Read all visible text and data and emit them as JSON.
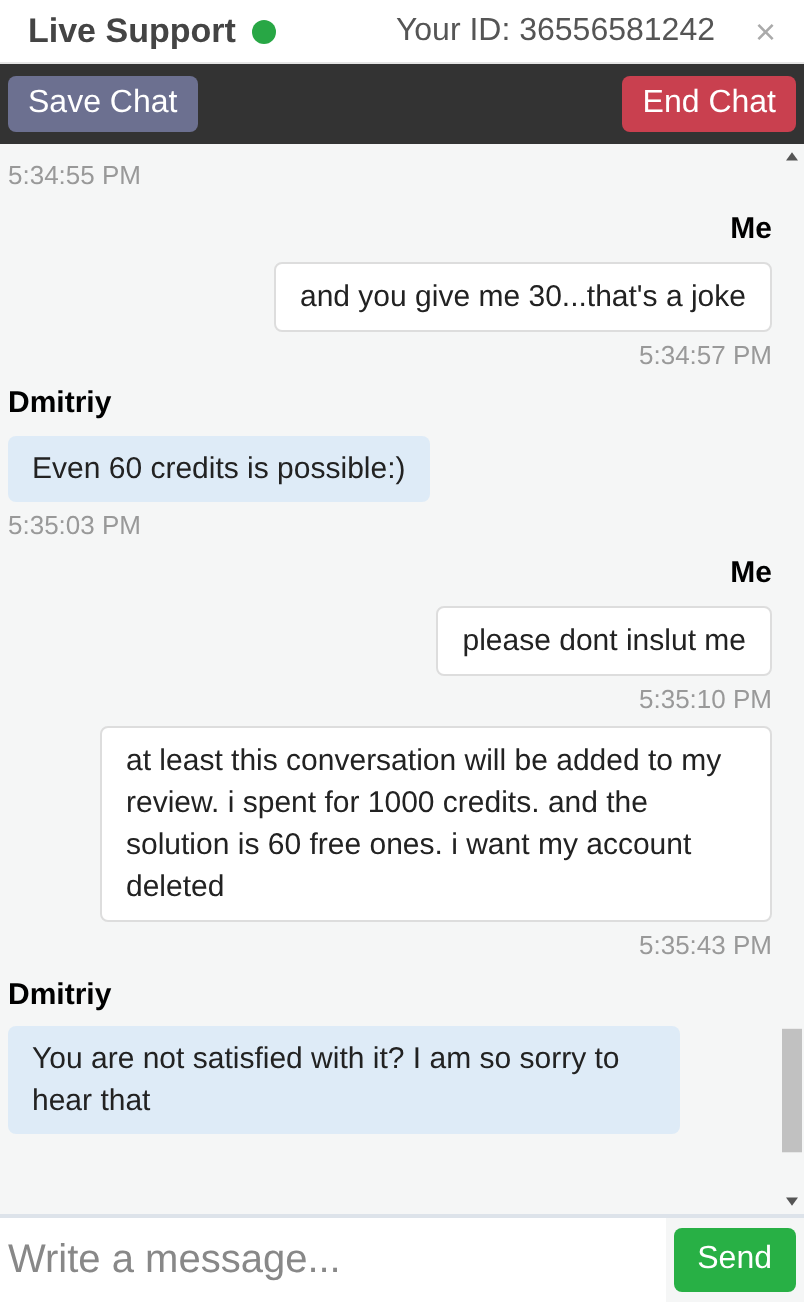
{
  "header": {
    "title": "Live Support",
    "online": true,
    "user_id": "Your ID: 36556581242",
    "close": "×"
  },
  "toolbar": {
    "save": "Save Chat",
    "end": "End Chat"
  },
  "chat": {
    "leading_time": "5:34:55 PM",
    "messages": [
      {
        "kind": "me",
        "sender": "Me",
        "text": "and you give me 30...that's a joke",
        "time": "5:34:57 PM"
      },
      {
        "kind": "agent",
        "sender": "Dmitriy",
        "text": "Even 60 credits is possible:)",
        "time": "5:35:03 PM"
      },
      {
        "kind": "me",
        "sender": "Me",
        "text": "please dont inslut me",
        "time": "5:35:10 PM"
      },
      {
        "kind": "me",
        "text": "at least this conversation will be added to my review. i spent for 1000 credits. and the solution is 60 free ones. i want my account deleted",
        "time": "5:35:43 PM"
      },
      {
        "kind": "agent",
        "sender": "Dmitriy",
        "text": "You are not satisfied with it? I am so sorry to hear that"
      }
    ]
  },
  "composer": {
    "placeholder": "Write a message...",
    "send": "Send"
  }
}
